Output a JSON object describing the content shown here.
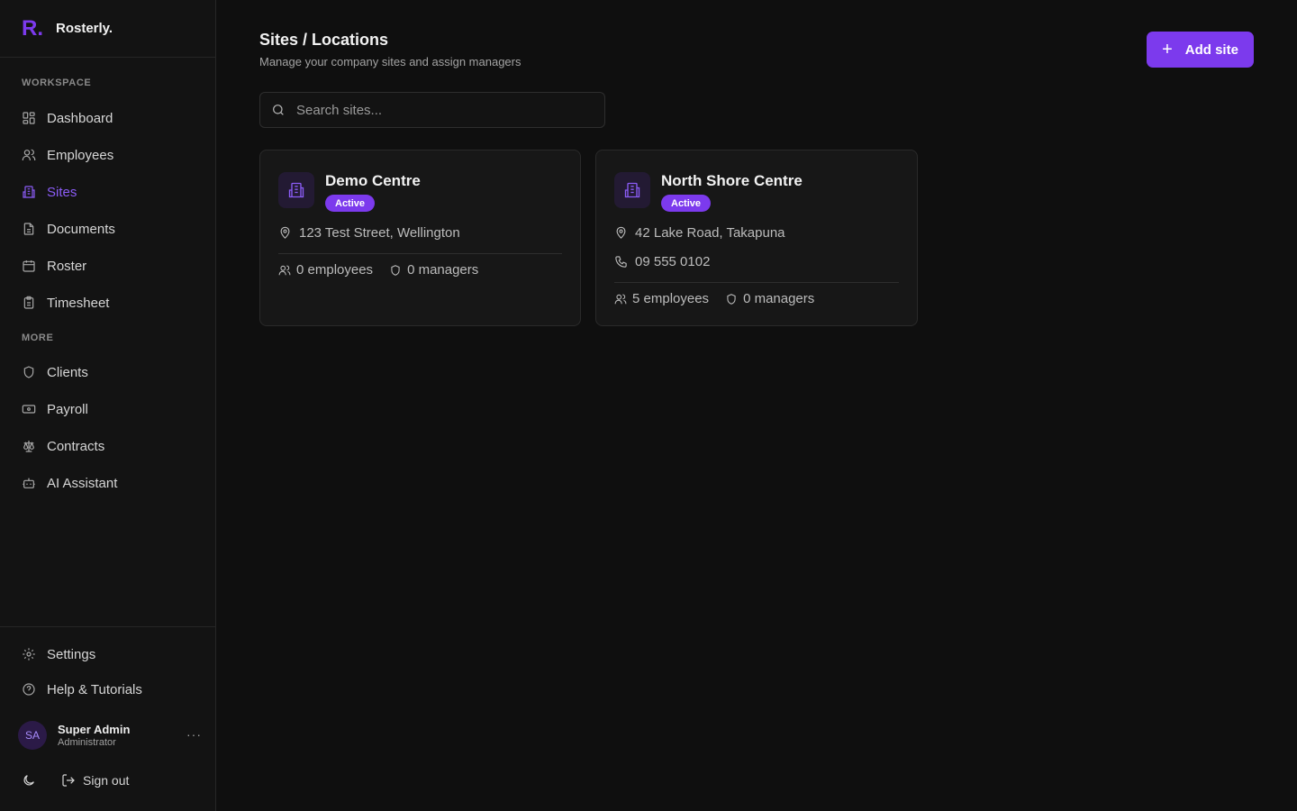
{
  "app": {
    "logo_mark": "R.",
    "name": "Rosterly."
  },
  "sidebar": {
    "workspace_label": "WORKSPACE",
    "more_label": "MORE",
    "workspace_items": [
      {
        "label": "Dashboard",
        "icon": "dashboard-icon"
      },
      {
        "label": "Employees",
        "icon": "users-icon"
      },
      {
        "label": "Sites",
        "icon": "building-icon",
        "active": true
      },
      {
        "label": "Documents",
        "icon": "document-icon"
      },
      {
        "label": "Roster",
        "icon": "calendar-icon"
      },
      {
        "label": "Timesheet",
        "icon": "clipboard-icon"
      }
    ],
    "more_items": [
      {
        "label": "Clients",
        "icon": "shield-icon"
      },
      {
        "label": "Payroll",
        "icon": "banknote-icon"
      },
      {
        "label": "Contracts",
        "icon": "scale-icon"
      },
      {
        "label": "AI Assistant",
        "icon": "bot-icon"
      }
    ],
    "settings_label": "Settings",
    "help_label": "Help & Tutorials",
    "user": {
      "initials": "SA",
      "name": "Super Admin",
      "role": "Administrator",
      "more": "···"
    },
    "sign_out": "Sign out"
  },
  "main": {
    "title": "Sites / Locations",
    "subtitle": "Manage your company sites and assign managers",
    "add_button": {
      "icon": "+",
      "label": "Add site"
    },
    "search_placeholder": "Search sites...",
    "sites": [
      {
        "name": "Demo Centre",
        "status": "Active",
        "address": "123 Test Street, Wellington",
        "employees": "0 employees",
        "managers": "0 managers"
      },
      {
        "name": "North Shore Centre",
        "status": "Active",
        "address": "42 Lake Road, Takapuna",
        "phone": "09 555 0102",
        "employees": "5 employees",
        "managers": "0 managers"
      }
    ]
  },
  "colors": {
    "accent": "#7c3aed",
    "background": "#0f0f0f",
    "sidebar": "#131313",
    "card": "#171717"
  }
}
